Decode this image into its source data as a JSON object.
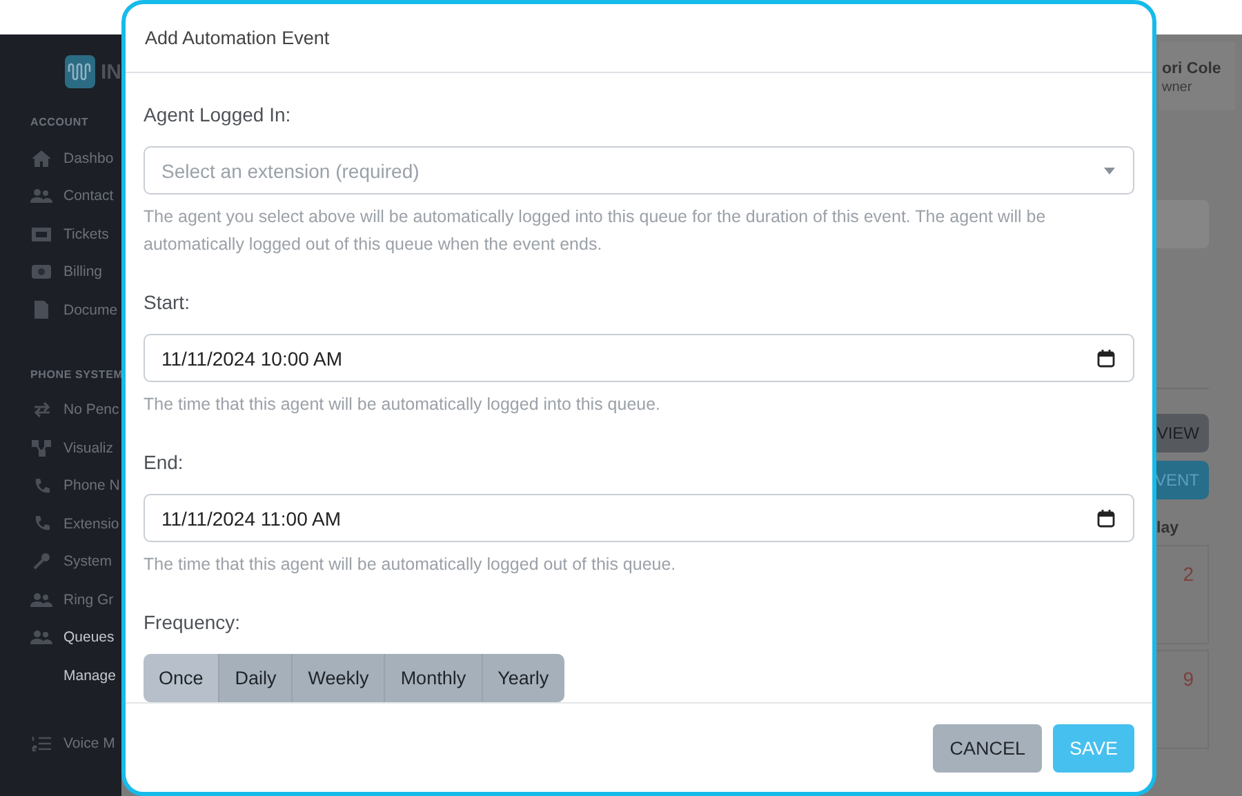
{
  "background": {
    "brand": "IN",
    "sidebar": {
      "sections": [
        {
          "heading": "ACCOUNT",
          "items": [
            {
              "label": "Dashbo"
            },
            {
              "label": "Contact"
            },
            {
              "label": "Tickets"
            },
            {
              "label": "Billing"
            },
            {
              "label": "Docume"
            }
          ]
        },
        {
          "heading": "PHONE SYSTEM",
          "items": [
            {
              "label": "No Penc"
            },
            {
              "label": "Visualiz"
            },
            {
              "label": "Phone N"
            },
            {
              "label": "Extensio"
            },
            {
              "label": "System"
            },
            {
              "label": "Ring Gr"
            },
            {
              "label": "Queues",
              "selected": true
            },
            {
              "label": "Manage",
              "selected": true
            }
          ]
        },
        {
          "items": [
            {
              "label": "Voice M"
            }
          ]
        }
      ]
    },
    "user": {
      "name": "ori Cole",
      "role": "wner"
    },
    "buttons": [
      "VIEW",
      "VENT"
    ],
    "column_heading": "lay",
    "days": [
      "2",
      "9"
    ]
  },
  "dialog": {
    "title": "Add Automation Event",
    "agent": {
      "label": "Agent Logged In:",
      "placeholder": "Select an extension (required)",
      "help": "The agent you select above will be automatically logged into this queue for the duration of this event. The agent will be automatically logged out of this queue when the event ends."
    },
    "start": {
      "label": "Start:",
      "value": "11/11/2024 10:00 AM",
      "help": "The time that this agent will be automatically logged into this queue."
    },
    "end": {
      "label": "End:",
      "value": "11/11/2024 11:00 AM",
      "help": "The time that this agent will be automatically logged out of this queue."
    },
    "frequency": {
      "label": "Frequency:",
      "options": [
        {
          "label": "Once",
          "selected": true
        },
        {
          "label": "Daily",
          "selected": false
        },
        {
          "label": "Weekly",
          "selected": false
        },
        {
          "label": "Monthly",
          "selected": false
        },
        {
          "label": "Yearly",
          "selected": false
        }
      ]
    },
    "buttons": [
      {
        "label": "CANCEL",
        "kind": "secondary"
      },
      {
        "label": "SAVE",
        "kind": "primary"
      }
    ]
  }
}
